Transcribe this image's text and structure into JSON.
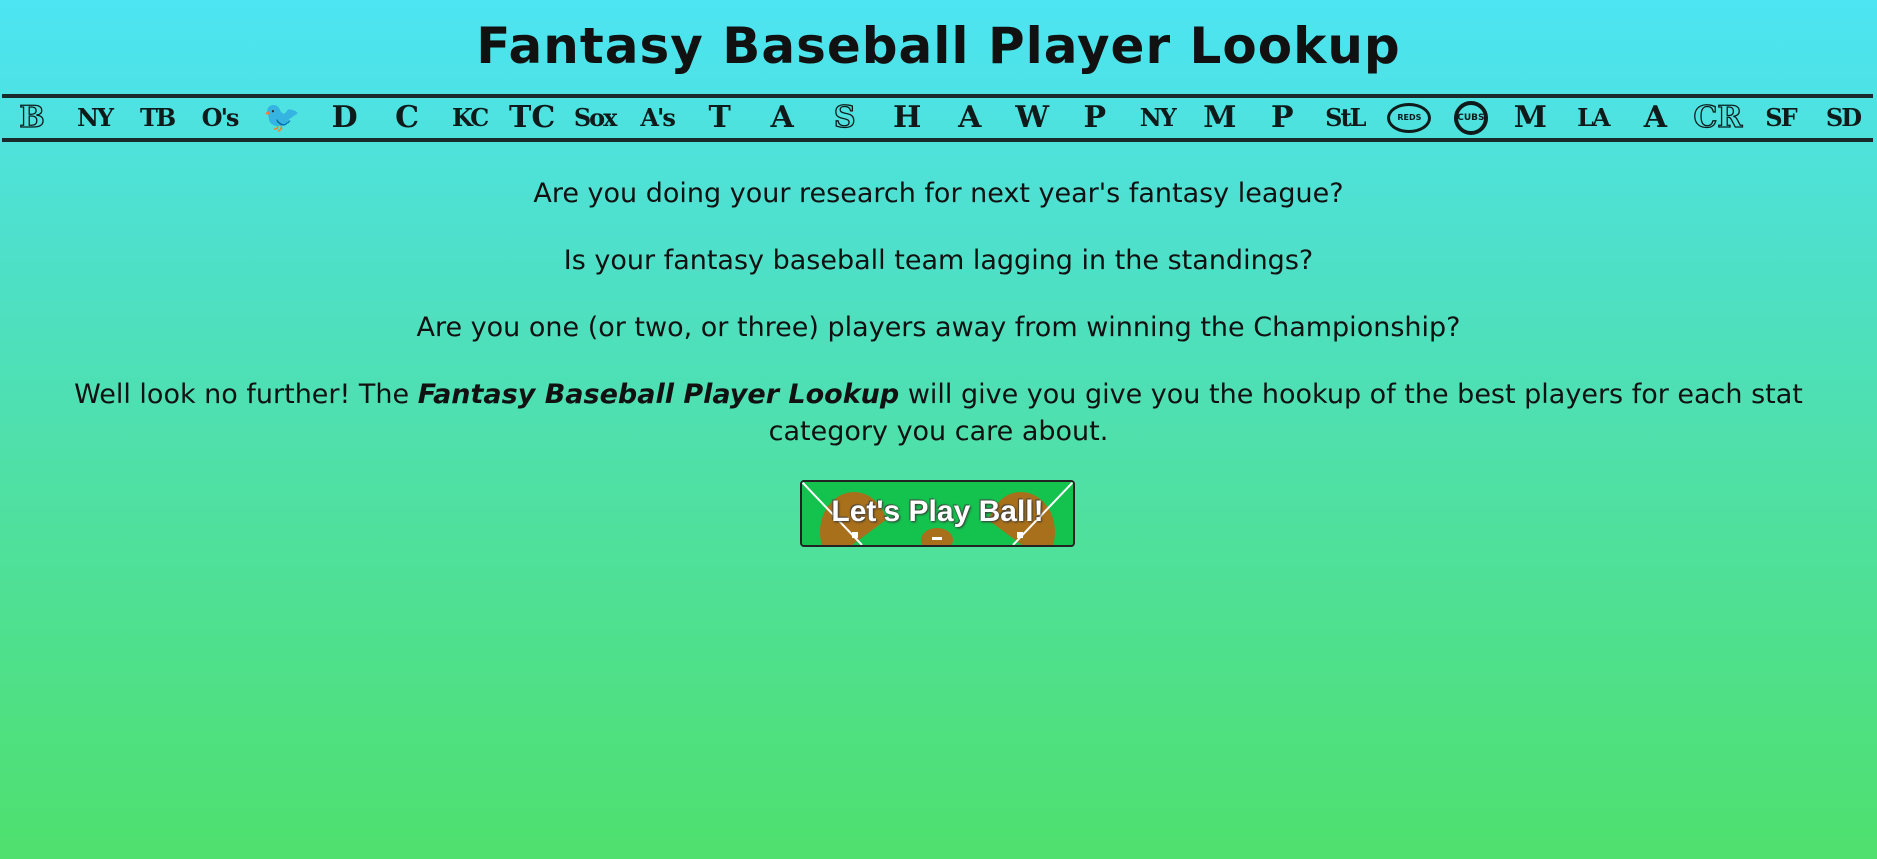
{
  "header": {
    "title": "Fantasy Baseball Player Lookup"
  },
  "teams": [
    {
      "abbr": "BOS",
      "glyph": "B",
      "icon": "red-sox-logo-icon"
    },
    {
      "abbr": "NYY",
      "glyph": "NY",
      "icon": "yankees-logo-icon"
    },
    {
      "abbr": "TB",
      "glyph": "TB",
      "icon": "rays-logo-icon"
    },
    {
      "abbr": "BAL",
      "glyph": "O's",
      "icon": "orioles-logo-icon"
    },
    {
      "abbr": "TOR",
      "glyph": "🐦",
      "icon": "blue-jays-logo-icon"
    },
    {
      "abbr": "DET",
      "glyph": "D",
      "icon": "tigers-logo-icon"
    },
    {
      "abbr": "CLE",
      "glyph": "C",
      "icon": "guardians-logo-icon"
    },
    {
      "abbr": "KC",
      "glyph": "KC",
      "icon": "royals-logo-icon"
    },
    {
      "abbr": "MIN",
      "glyph": "TC",
      "icon": "twins-logo-icon"
    },
    {
      "abbr": "CWS",
      "glyph": "Sox",
      "icon": "white-sox-logo-icon"
    },
    {
      "abbr": "OAK",
      "glyph": "A's",
      "icon": "athletics-logo-icon"
    },
    {
      "abbr": "TEX",
      "glyph": "T",
      "icon": "rangers-logo-icon"
    },
    {
      "abbr": "LAA",
      "glyph": "A",
      "icon": "angels-logo-icon"
    },
    {
      "abbr": "SEA",
      "glyph": "S",
      "icon": "mariners-logo-icon"
    },
    {
      "abbr": "HOU",
      "glyph": "H",
      "icon": "astros-logo-icon"
    },
    {
      "abbr": "ATL",
      "glyph": "A",
      "icon": "braves-logo-icon"
    },
    {
      "abbr": "WSH",
      "glyph": "W",
      "icon": "nationals-logo-icon"
    },
    {
      "abbr": "PHI",
      "glyph": "P",
      "icon": "phillies-logo-icon"
    },
    {
      "abbr": "NYM",
      "glyph": "NY",
      "icon": "mets-logo-icon"
    },
    {
      "abbr": "MIA",
      "glyph": "M",
      "icon": "marlins-logo-icon"
    },
    {
      "abbr": "PIT",
      "glyph": "P",
      "icon": "pirates-logo-icon"
    },
    {
      "abbr": "STL",
      "glyph": "StL",
      "icon": "cardinals-logo-icon"
    },
    {
      "abbr": "CIN",
      "glyph": "REDS",
      "icon": "reds-logo-icon"
    },
    {
      "abbr": "CHC",
      "glyph": "CUBS",
      "icon": "cubs-logo-icon"
    },
    {
      "abbr": "MIL",
      "glyph": "M",
      "icon": "brewers-logo-icon"
    },
    {
      "abbr": "LAD",
      "glyph": "LA",
      "icon": "dodgers-logo-icon"
    },
    {
      "abbr": "ARI",
      "glyph": "A",
      "icon": "diamondbacks-logo-icon"
    },
    {
      "abbr": "COL",
      "glyph": "CR",
      "icon": "rockies-logo-icon"
    },
    {
      "abbr": "SF",
      "glyph": "SF",
      "icon": "giants-logo-icon"
    },
    {
      "abbr": "SD",
      "glyph": "SD",
      "icon": "padres-logo-icon"
    }
  ],
  "intro": {
    "line1": "Are you doing your research for next year's fantasy league?",
    "line2": "Is your fantasy baseball team lagging in the standings?",
    "line3": "Are you one (or two, or three) players away from winning the Championship?",
    "line4_before": "Well look no further! The ",
    "line4_emphasis": "Fantasy Baseball Player Lookup",
    "line4_after": " will give you give you the hookup of the best players for each stat category you care about."
  },
  "cta": {
    "label": "Let's Play Ball!"
  },
  "colors": {
    "gradient_top": "#4de4f4",
    "gradient_bottom": "#4fe06e",
    "field_green": "#14c24e",
    "infield_dirt": "#a8701a"
  }
}
